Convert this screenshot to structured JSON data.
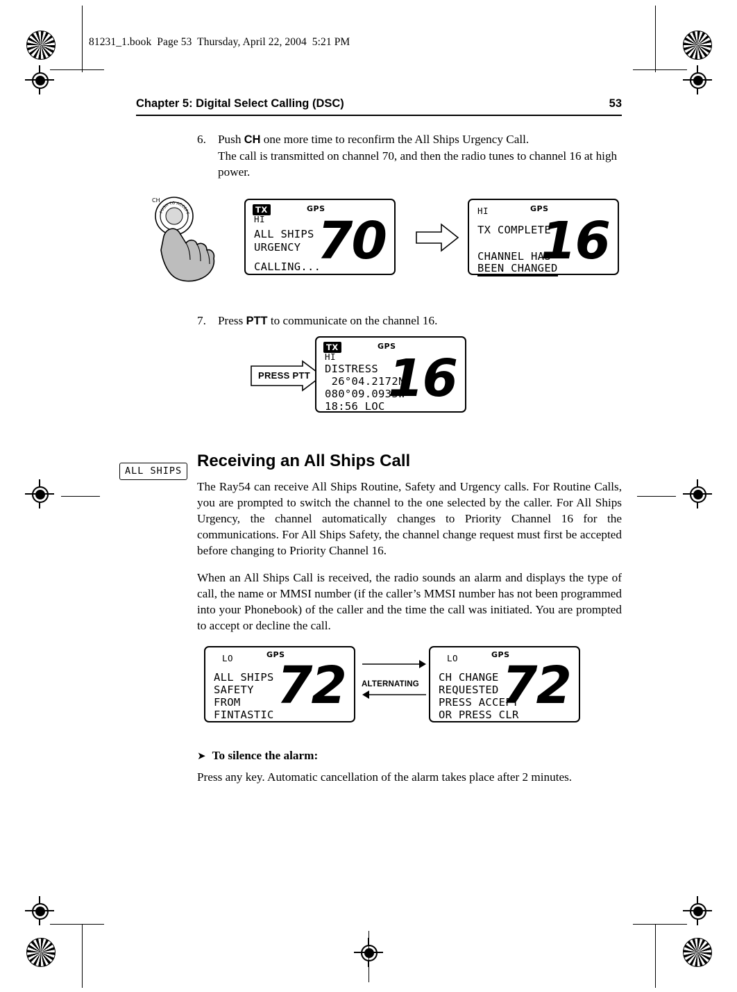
{
  "print_header": "81231_1.book  Page 53  Thursday, April 22, 2004  5:21 PM",
  "header": {
    "chapter": "Chapter 5: Digital Select Calling (DSC)",
    "page_number": "53"
  },
  "steps": [
    {
      "num": "6.",
      "pre": "Push ",
      "key": "CH",
      "post": " one more time to reconfirm the All Ships Urgency Call.",
      "line2": "The call is transmitted on channel 70, and then the radio tunes to channel 16 at high power."
    },
    {
      "num": "7.",
      "pre": "Press ",
      "key": "PTT",
      "post": " to communicate on the channel 16.",
      "line2": ""
    }
  ],
  "screens": {
    "s1": {
      "tx": "TX",
      "power": "HI",
      "gps": "GPS",
      "lines": [
        "ALL SHIPS",
        "URGENCY",
        "",
        "CALLING..."
      ],
      "channel": "70"
    },
    "s2": {
      "tx": "",
      "power": "HI",
      "gps": "GPS",
      "lines": [
        "TX COMPLETE",
        "",
        "CHANNEL HAS",
        "BEEN CHANGED"
      ],
      "channel": "16"
    },
    "s3": {
      "tx": "TX",
      "power": "HI",
      "gps": "GPS",
      "lines": [
        "DISTRESS",
        " 26°04.2172N",
        "080°09.0933W",
        "18:56 LOC"
      ],
      "channel": "16",
      "callout": "PRESS PTT"
    },
    "s4": {
      "tx": "",
      "power": "LO",
      "gps": "GPS",
      "lines": [
        "ALL SHIPS",
        "SAFETY",
        "FROM",
        "FINTASTIC"
      ],
      "channel": "72"
    },
    "s5": {
      "tx": "",
      "power": "LO",
      "gps": "GPS",
      "lines": [
        "CH CHANGE",
        "REQUESTED",
        "PRESS ACCEPT",
        "OR PRESS CLR"
      ],
      "channel": "72"
    },
    "alternating_label": "ALTERNATING"
  },
  "section": {
    "title": "Receiving an All Ships Call",
    "side_tag": "ALL SHIPS",
    "para1": "The Ray54 can receive All Ships Routine, Safety and Urgency calls. For Routine Calls, you are prompted to switch the channel to the one selected by the caller. For All Ships Urgency, the channel automatically changes to Priority Channel 16 for the communications. For All Ships Safety, the channel change request must first be accepted before changing to Priority Channel 16.",
    "para2": "When an All Ships Call is received, the radio sounds an alarm and displays the type of call, the name or MMSI number (if the caller’s MMSI number has not been programmed into your Phonebook) of the caller and the time the call was initiated. You are prompted to accept or decline the call.",
    "subhead_arrow": "➤",
    "subhead": "To silence the alarm:",
    "para3": "Press any key. Automatic cancellation of the alarm takes place after 2 minutes."
  },
  "knob": {
    "label_top": "CH",
    "label_arc": "PUSH TO ACCEPT"
  }
}
